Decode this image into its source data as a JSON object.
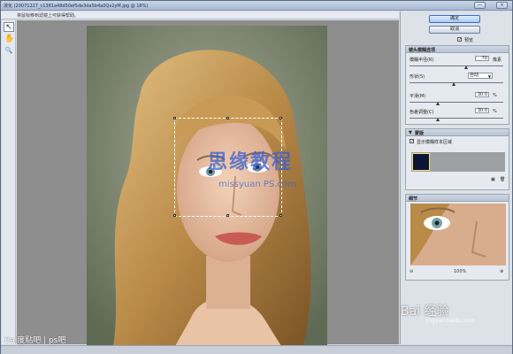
{
  "titlebar": {
    "title": "液化 (20071227_c1381a48d50ef5de3da5b4a0Qx2yM.jpg @ 18%)",
    "minimize": "—",
    "close": "✕"
  },
  "hint": "将鼠标移到滤镜上可获得帮助。",
  "tools": [
    "arrow-icon",
    "hand-icon",
    "zoom-icon"
  ],
  "tool_glyphs": [
    "↖",
    "✋",
    "🔍"
  ],
  "canvas": {
    "watermark_cn": "思缘教程",
    "watermark_url": "missyuan PS.com"
  },
  "panel": {
    "ok_label": "确定",
    "cancel_label": "取消",
    "preview_label": "预览",
    "options_title": "镜头模糊选项",
    "radius_label": "模糊半径(R)",
    "radius_value": "70",
    "radius_unit": "像素",
    "shape_label": "形状(S)",
    "shape_value": "自动",
    "smooth_label": "平滑(M)",
    "smooth_value": "30.0",
    "smooth_unit": "%",
    "chroma_label": "色差调整(C)",
    "chroma_value": "30.0",
    "chroma_unit": "%",
    "mask_title": "蒙版",
    "mask_show_label": "显示模糊样本区域",
    "detail_title": "细节",
    "zoom_value": "100%"
  },
  "status": {
    "baidu_left": "Bai度贴吧 | ps吧",
    "baidu_right": "Bai 经验",
    "baidu_url": "jingyan.baidu.com"
  }
}
